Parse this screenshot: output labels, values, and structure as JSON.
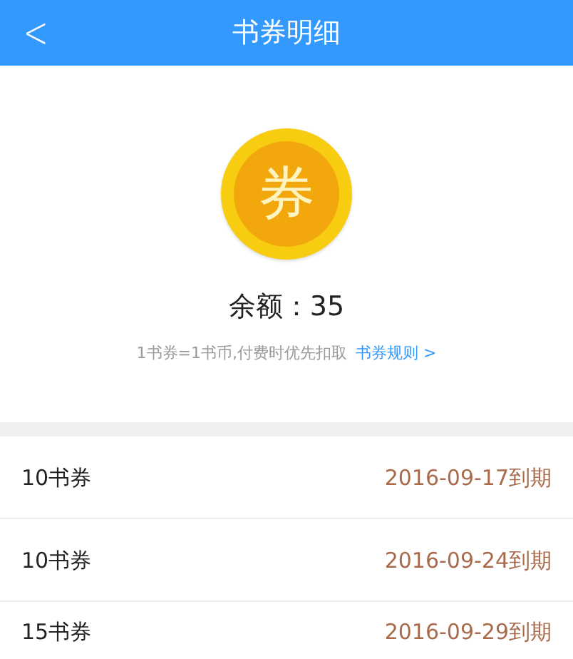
{
  "header": {
    "back": "<",
    "title": "书券明细"
  },
  "summary": {
    "coin_glyph": "券",
    "balance": "余额：35",
    "note": "1书券=1书币,付费时优先扣取",
    "rules_link": "书券规则 >"
  },
  "vouchers": [
    {
      "amount": "10书券",
      "expiry": "2016-09-17到期"
    },
    {
      "amount": "10书券",
      "expiry": "2016-09-24到期"
    },
    {
      "amount": "15书券",
      "expiry": "2016-09-29到期"
    }
  ]
}
